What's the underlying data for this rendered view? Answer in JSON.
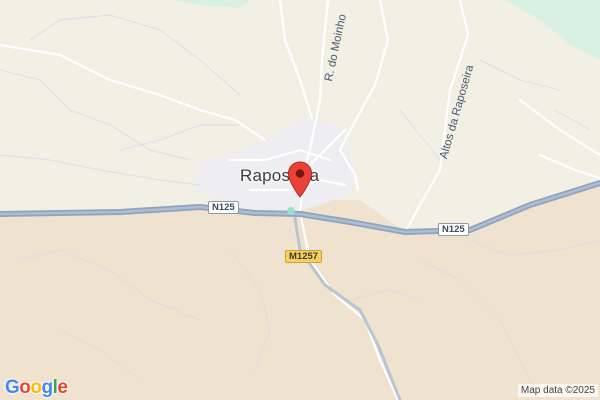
{
  "map": {
    "place_name": "Raposeira",
    "place_label_visible": "Raposeira",
    "streets": {
      "moinho": "R. do Moinho",
      "altos": "Altos da Raposeira"
    },
    "route_shields": {
      "n125_left": "N125",
      "n125_right": "N125",
      "m1257": "M1257"
    },
    "pin_icon": "map-pin-icon",
    "colors": {
      "land": "#f2efe4",
      "terrain": "#efe3cf",
      "urban": "#eeeef2",
      "green": "#d9f1e2",
      "highway": "#8fa3bd",
      "pin": "#ea4335"
    }
  },
  "footer": {
    "logo": "Google",
    "attribution": "Map data ©2025"
  }
}
